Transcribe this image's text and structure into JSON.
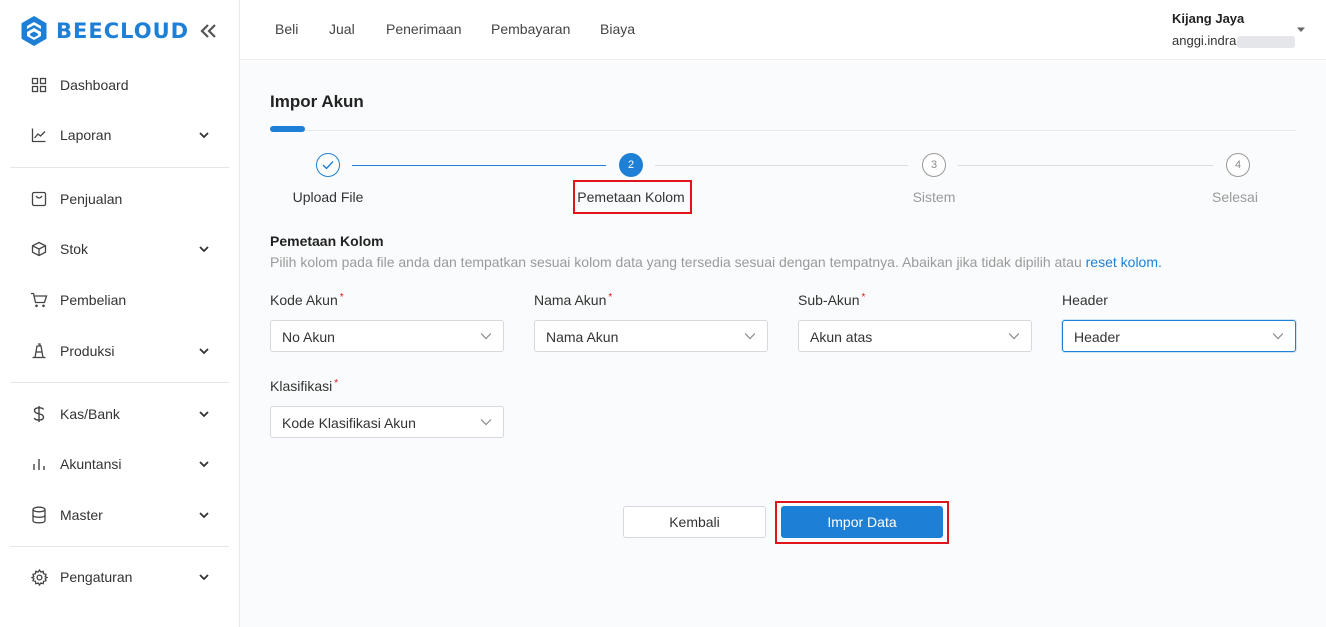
{
  "brand": {
    "name": "BEECLOUD",
    "color": "#1e7fd6",
    "logo_icon": "hexagon-logo-icon"
  },
  "sidebar": {
    "items": [
      {
        "label": "Dashboard",
        "icon": "dashboard-grid-icon",
        "has_submenu": false
      },
      {
        "label": "Laporan",
        "icon": "chart-line-icon",
        "has_submenu": true
      },
      {
        "label": "Penjualan",
        "icon": "sales-box-icon",
        "has_submenu": false
      },
      {
        "label": "Stok",
        "icon": "cube-icon",
        "has_submenu": true
      },
      {
        "label": "Pembelian",
        "icon": "cart-icon",
        "has_submenu": false
      },
      {
        "label": "Produksi",
        "icon": "factory-icon",
        "has_submenu": true
      },
      {
        "label": "Kas/Bank",
        "icon": "dollar-icon",
        "has_submenu": true
      },
      {
        "label": "Akuntansi",
        "icon": "bar-chart-icon",
        "has_submenu": true
      },
      {
        "label": "Master",
        "icon": "database-icon",
        "has_submenu": true
      },
      {
        "label": "Pengaturan",
        "icon": "gear-icon",
        "has_submenu": true
      }
    ]
  },
  "topbar": {
    "menu": [
      "Beli",
      "Jual",
      "Penerimaan",
      "Pembayaran",
      "Biaya"
    ],
    "user": {
      "company": "Kijang Jaya",
      "email_visible": "anggi.indra"
    }
  },
  "page": {
    "title": "Impor Akun",
    "steps": [
      {
        "number": "1",
        "label": "Upload File",
        "status": "done"
      },
      {
        "number": "2",
        "label": "Pemetaan Kolom",
        "status": "active"
      },
      {
        "number": "3",
        "label": "Sistem",
        "status": "pending"
      },
      {
        "number": "4",
        "label": "Selesai",
        "status": "pending"
      }
    ],
    "section": {
      "title": "Pemetaan Kolom",
      "description": "Pilih kolom pada file anda dan tempatkan sesuai kolom data yang tersedia sesuai dengan tempatnya. Abaikan jika tidak dipilih atau",
      "reset_link": "reset kolom."
    },
    "fields": [
      {
        "label": "Kode Akun",
        "required": true,
        "value": "No Akun"
      },
      {
        "label": "Nama Akun",
        "required": true,
        "value": "Nama Akun"
      },
      {
        "label": "Sub-Akun",
        "required": true,
        "value": "Akun atas"
      },
      {
        "label": "Header",
        "required": false,
        "value": "Header"
      },
      {
        "label": "Klasifikasi",
        "required": true,
        "value": "Kode Klasifikasi Akun"
      }
    ],
    "required_mark": "*",
    "buttons": {
      "back": "Kembali",
      "import": "Impor Data"
    }
  },
  "colors": {
    "primary": "#1e7fd6",
    "highlight": "#e0141a",
    "muted": "#9a9a9a"
  }
}
